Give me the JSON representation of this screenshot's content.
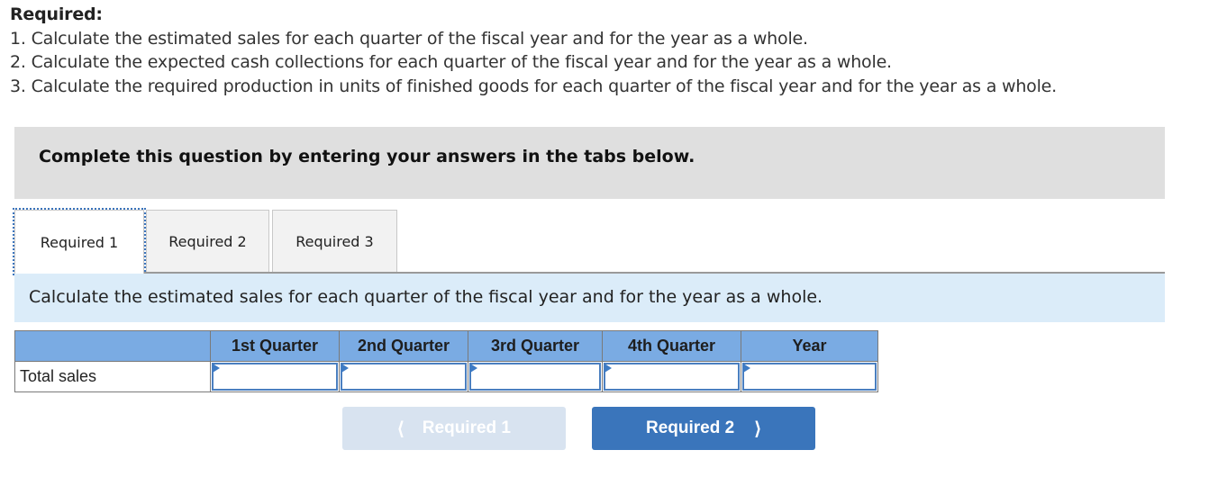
{
  "requirements": {
    "title": "Required:",
    "items": [
      "1. Calculate the estimated sales for each quarter of the fiscal year and for the year as a whole.",
      "2. Calculate the expected cash collections for each quarter of the fiscal year and for the year as a whole.",
      "3. Calculate the required production in units of finished goods for each quarter of the fiscal year and for the year as a whole."
    ]
  },
  "instructions": {
    "text": "Complete this question by entering your answers in the tabs below."
  },
  "tabs": [
    {
      "label": "Required 1",
      "active": true
    },
    {
      "label": "Required 2",
      "active": false
    },
    {
      "label": "Required 3",
      "active": false
    }
  ],
  "active_tab": {
    "prompt": "Calculate the estimated sales for each quarter of the fiscal year and for the year as a whole."
  },
  "table": {
    "columns": [
      "",
      "1st Quarter",
      "2nd Quarter",
      "3rd Quarter",
      "4th Quarter",
      "Year"
    ],
    "rows": [
      {
        "label": "Total sales",
        "values": [
          "",
          "",
          "",
          "",
          ""
        ]
      }
    ]
  },
  "navigation": {
    "prev_label": "Required 1",
    "prev_icon": "chevron-left-icon",
    "prev_enabled": false,
    "next_label": "Required 2",
    "next_icon": "chevron-right-icon",
    "next_enabled": true
  },
  "colors": {
    "header_blue": "#7aabe3",
    "info_band": "#dbecf9",
    "instruction_gray": "#dfdfdf",
    "next_button": "#3a75bb",
    "prev_button_disabled": "#d8e3f0"
  }
}
